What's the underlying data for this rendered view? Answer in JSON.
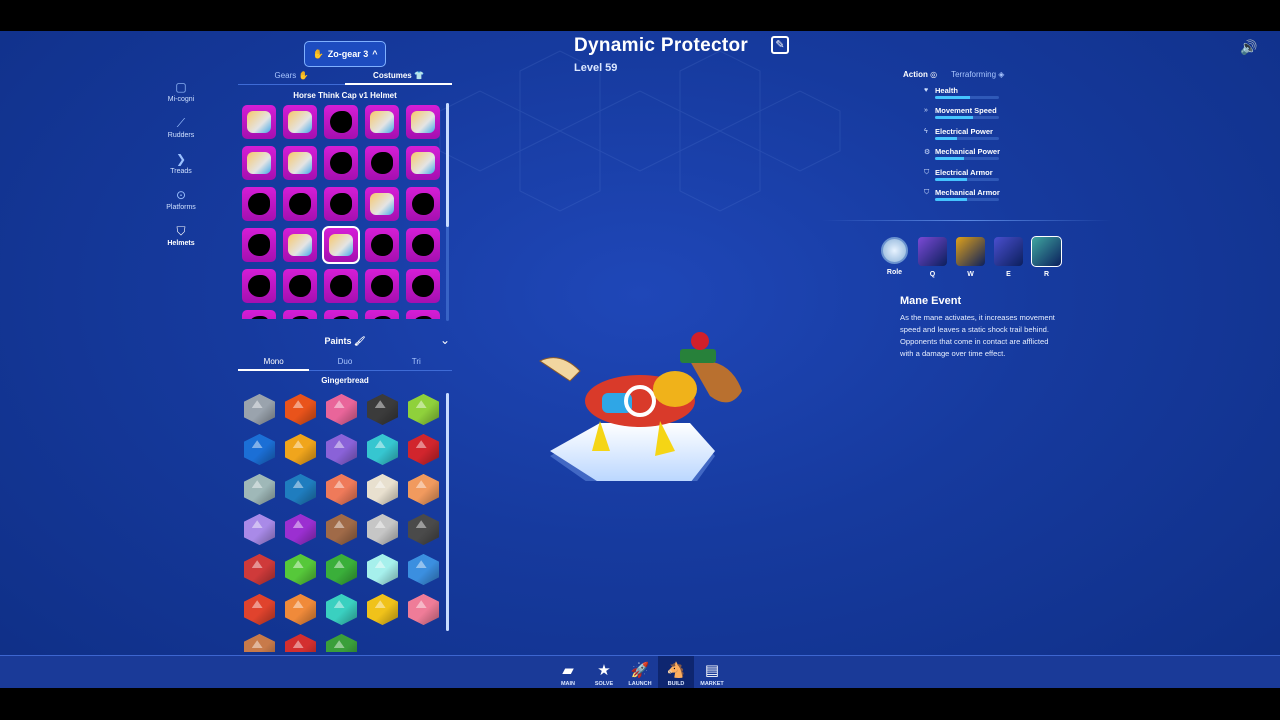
{
  "gear_dropdown": {
    "label": "Zo-gear 3",
    "chevron": "^"
  },
  "left_nav": {
    "items": [
      {
        "label": "Mi-cogni",
        "icon": "square-face-icon",
        "active": false
      },
      {
        "label": "Rudders",
        "icon": "rudder-icon",
        "active": false
      },
      {
        "label": "Treads",
        "icon": "tread-icon",
        "active": false
      },
      {
        "label": "Platforms",
        "icon": "platform-icon",
        "active": false
      },
      {
        "label": "Helmets",
        "icon": "helmet-icon",
        "active": true
      }
    ]
  },
  "tabs": {
    "gears": "Gears",
    "costumes": "Costumes",
    "active": "costumes"
  },
  "helmet_title": "Horse Think Cap v1 Helmet",
  "robot": {
    "name": "Dynamic Protector",
    "level": "Level 59"
  },
  "stats_tabs": {
    "action": "Action",
    "terraforming": "Terraforming"
  },
  "stats": [
    {
      "label": "Health",
      "value": 0.55
    },
    {
      "label": "Movement Speed",
      "value": 0.6
    },
    {
      "label": "Electrical Power",
      "value": 0.35
    },
    {
      "label": "Mechanical Power",
      "value": 0.45
    },
    {
      "label": "Electrical Armor",
      "value": 0.5
    },
    {
      "label": "Mechanical Armor",
      "value": 0.5
    }
  ],
  "abilities": [
    {
      "key": "Role",
      "color": "#9ec4ea"
    },
    {
      "key": "Q",
      "color": "#7b4ad6"
    },
    {
      "key": "W",
      "color": "#e0a21a"
    },
    {
      "key": "E",
      "color": "#4a4fcf"
    },
    {
      "key": "R",
      "color": "#3fa7a0"
    }
  ],
  "ability_detail": {
    "title": "Mane Event",
    "description": "As the mane activates, it increases movement speed and leaves a static shock trail behind. Opponents that come in contact are afflicted with a damage over time effect."
  },
  "paints": {
    "header": "Paints",
    "tabs": [
      "Mono",
      "Duo",
      "Tri"
    ],
    "active_tab": "Mono",
    "title": "Gingerbread",
    "swatches": [
      "#9aa3ad",
      "#e9531b",
      "#e9659a",
      "#3b3b3b",
      "#8fd13b",
      "#1b6fd6",
      "#f0a51c",
      "#8a62d8",
      "#36c6d0",
      "#d1252d",
      "#9fb8b8",
      "#1f7dbf",
      "#ef7a5a",
      "#e8e0cf",
      "#f19a5e",
      "#a98ae8",
      "#9b2fd1",
      "#a06a48",
      "#c6c6c6",
      "#4a4a4a",
      "#cf3a3a",
      "#56c83a",
      "#3aaf3a",
      "#a6f0ec",
      "#3b8fe0",
      "#e0432d",
      "#f08a3a",
      "#3ad0c0",
      "#f0c21a",
      "#ef7c98",
      "#c87a4a",
      "#d32f2f",
      "#3a9f3a"
    ]
  },
  "bottom_nav": [
    {
      "label": "MAIN",
      "icon": "card-icon",
      "active": false
    },
    {
      "label": "SOLVE",
      "icon": "star-icon",
      "active": false
    },
    {
      "label": "LAUNCH",
      "icon": "rocket-icon",
      "active": false
    },
    {
      "label": "BUILD",
      "icon": "robot-icon",
      "active": true
    },
    {
      "label": "MARKET",
      "icon": "market-icon",
      "active": false
    }
  ]
}
